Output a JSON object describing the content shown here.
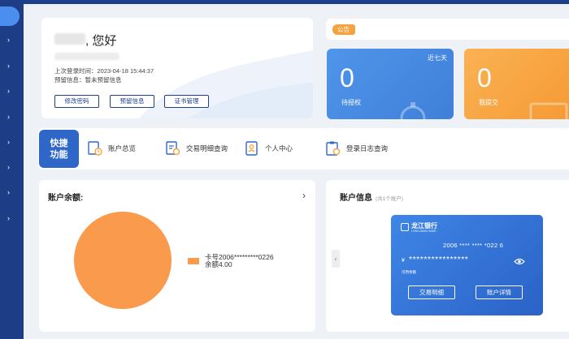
{
  "user": {
    "greeting": ", 您好",
    "last_login": "上次登录时间：2023-04-18 15:44:37",
    "reserve_info": "预留信息：暂未预留信息",
    "buttons": [
      "修改密码",
      "预留信息",
      "证书管理"
    ]
  },
  "notice": {
    "tag": "公告"
  },
  "stats": [
    {
      "value": "0",
      "label": "待授权",
      "range": "近七天"
    },
    {
      "value": "0",
      "label": "我提交",
      "range": "近"
    }
  ],
  "quick": {
    "title_line1": "快捷",
    "title_line2": "功能",
    "items": [
      {
        "label": "账户总览",
        "icon": "account-overview-icon"
      },
      {
        "label": "交易明细查询",
        "icon": "transaction-query-icon"
      },
      {
        "label": "个人中心",
        "icon": "personal-center-icon"
      },
      {
        "label": "登录日志查询",
        "icon": "login-log-icon"
      }
    ]
  },
  "balance": {
    "title": "账户余额:",
    "legend_card": "卡号2006*********0226",
    "legend_amount": "余额4.00"
  },
  "account": {
    "title": "账户信息",
    "count": "(共1个账户)",
    "bank_name": "龙江银行",
    "bank_en": "LONGJIANG BANK",
    "card_number": "2006 **** **** *022 6",
    "amount_prefix": "¥",
    "amount_mask": "****************",
    "available_label": "可用余额",
    "buttons": [
      "交易明细",
      "账户详情"
    ]
  },
  "chart_data": {
    "type": "pie",
    "slices": [
      {
        "label": "卡号2006*********0226",
        "value": 4.0
      }
    ],
    "colors": [
      "#f99a4c"
    ]
  },
  "colors": {
    "sidebar": "#1d3d86",
    "primary": "#2f67c9",
    "stat_blue": "#4a8ce5",
    "stat_orange": "#f7a53e",
    "pie": "#f99a4c"
  }
}
